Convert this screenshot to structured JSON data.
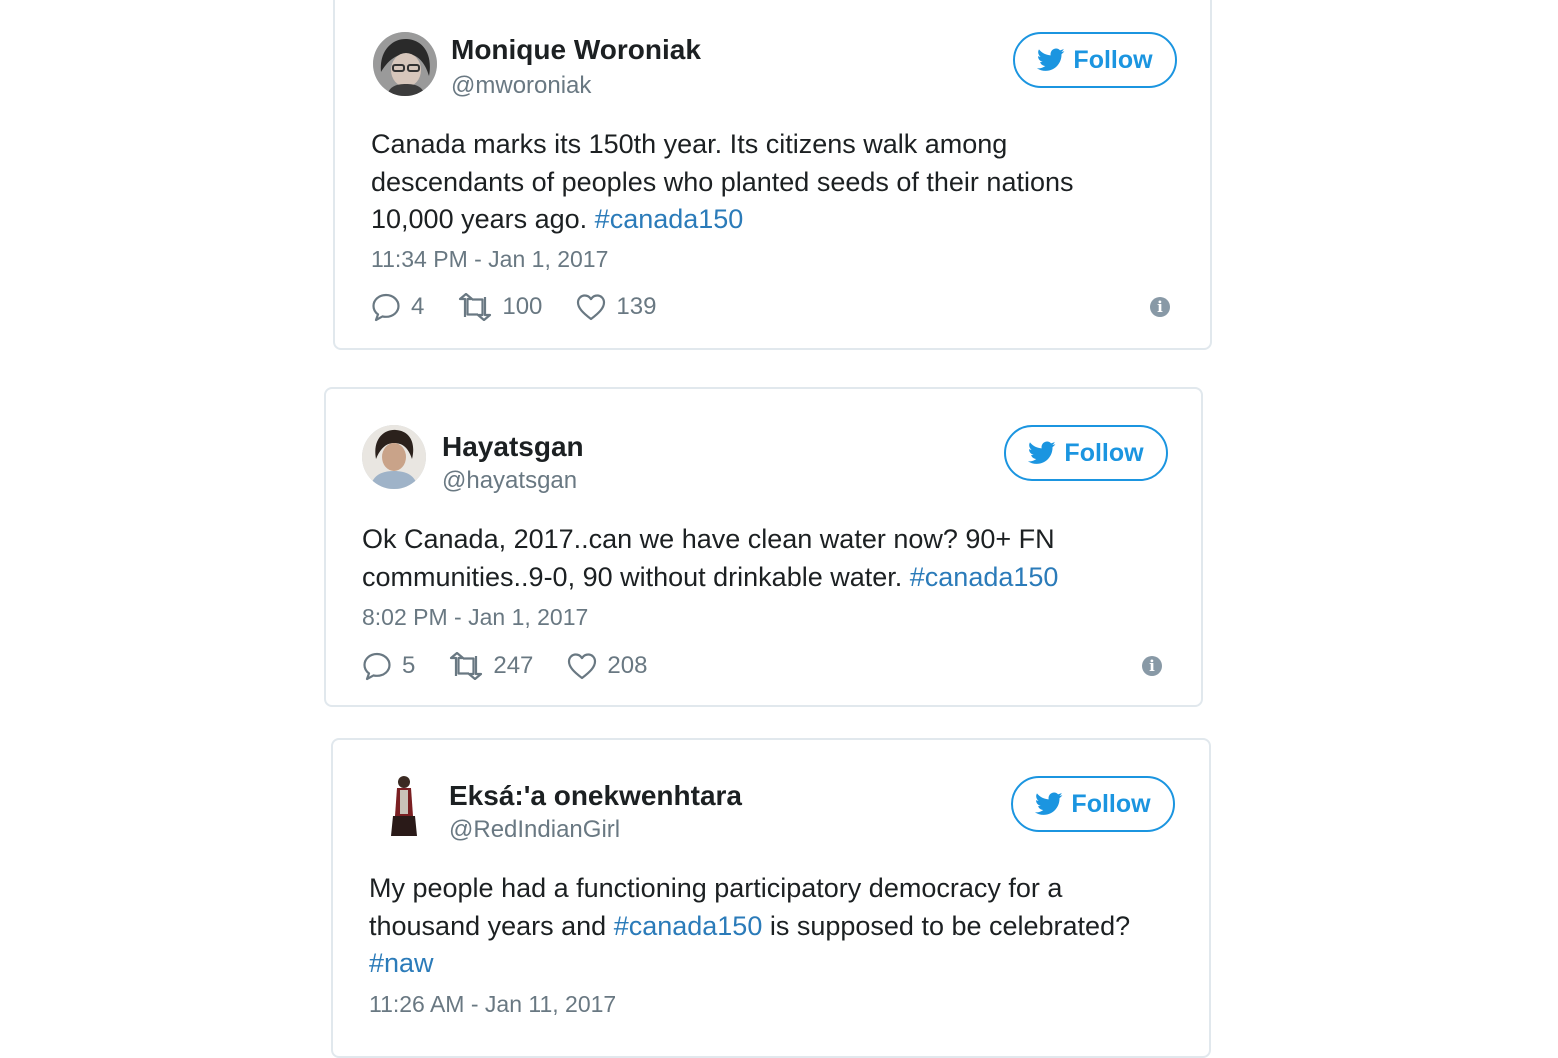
{
  "colors": {
    "link": "#2b7bb9",
    "follow_blue": "#1b95e0",
    "muted_text": "#697882",
    "border": "#e1e8ed"
  },
  "tweets": [
    {
      "name": "Monique Woroniak",
      "handle": "@mworoniak",
      "follow_label": "Follow",
      "text_segments": [
        {
          "text": "Canada marks its 150th year. Its citizens walk among",
          "hashtag": false
        },
        {
          "text": "descendants of peoples who planted seeds of their nations",
          "hashtag": false
        },
        {
          "text": "10,000 years ago. ",
          "hashtag": false
        },
        {
          "text": "#canada150",
          "hashtag": true
        }
      ],
      "timestamp": "11:34 PM - Jan 1, 2017",
      "replies": "4",
      "retweets": "100",
      "likes": "139",
      "avatar_icon": "avatar-portrait-glasses",
      "info_icon": "info-icon"
    },
    {
      "name": "Hayatsgan",
      "handle": "@hayatsgan",
      "follow_label": "Follow",
      "timestamp": "8:02 PM - Jan 1, 2017",
      "text_line1": "Ok Canada, 2017..can we have clean water now? 90+ FN",
      "text_line2": "communities..9-0, 90 without drinkable water. ",
      "hashtag_1": "#canada150",
      "replies": "5",
      "retweets": "247",
      "likes": "208"
    },
    {
      "name": "Eksá:'a onekwenhtara",
      "handle": "@RedIndianGirl",
      "follow_label": "Follow",
      "text_line1": "My people had a functioning participatory democracy for a",
      "text_line2_a": "thousand years and ",
      "hashtag_1": "#canada150",
      "text_line2_b": " is supposed to be celebrated?",
      "hashtag_2": "#naw",
      "timestamp": "11:26 AM - Jan 11, 2017"
    }
  ]
}
